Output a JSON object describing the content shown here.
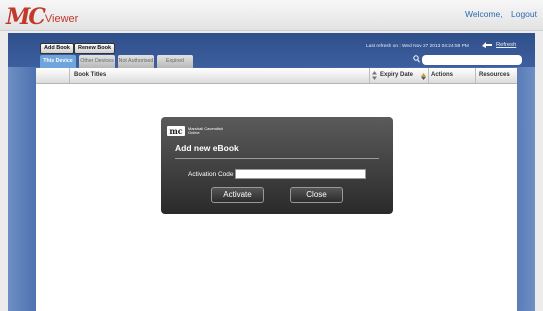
{
  "header": {
    "logo_mark": "MC",
    "logo_text": "Viewer",
    "welcome": "Welcome,",
    "logout": "Logout"
  },
  "toolbar": {
    "add_book": "Add Book",
    "renew_book": "Renew Book",
    "last_refresh": "Last refresh on : Wed Nov 27 2013 04:24:59 PM",
    "refresh": "Refresh",
    "search_placeholder": ""
  },
  "tabs": [
    {
      "label": "This Device",
      "active": true
    },
    {
      "label": "Other Devices",
      "active": false
    },
    {
      "label": "Not Authorised",
      "active": false
    },
    {
      "label": "Expired",
      "active": false
    }
  ],
  "table": {
    "columns": [
      "Book Titles",
      "Expiry Date",
      "Actions",
      "Resources"
    ],
    "rows": []
  },
  "modal": {
    "logo_badge": "mc",
    "brand_line1": "Marshall Cavendish",
    "brand_line2": "Online",
    "title": "Add new eBook",
    "activation_label": "Activation Code",
    "activation_value": "",
    "activate_button": "Activate",
    "close_button": "Close"
  },
  "colors": {
    "brand_red": "#c0392b",
    "frame_blue": "#3f5f9e",
    "active_tab": "#6fa4dc",
    "link_blue": "#2a6bb3",
    "modal_bg": "#3a3a3a"
  },
  "icons": [
    "refresh-icon",
    "search-icon",
    "sort-icon"
  ]
}
